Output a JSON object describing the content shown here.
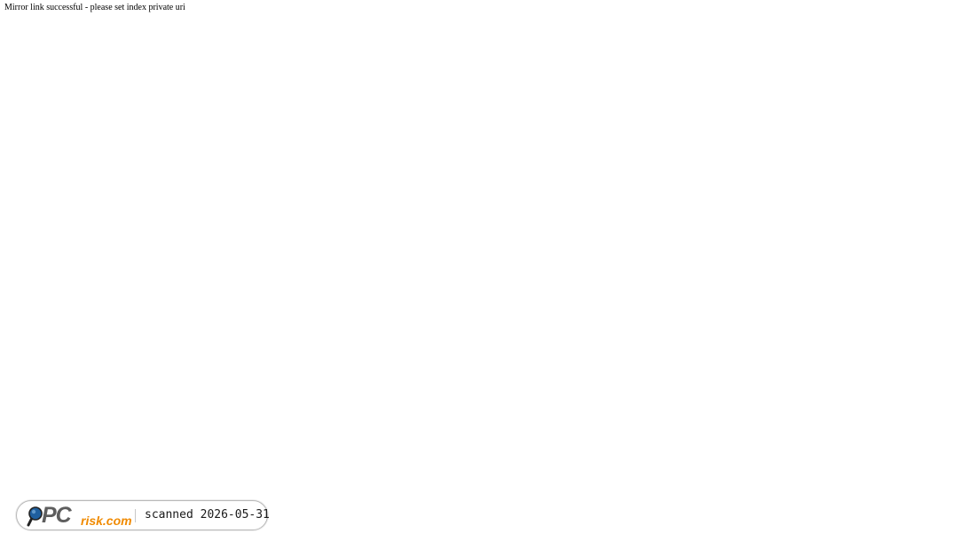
{
  "page": {
    "message": "Mirror link successful - please set index private uri"
  },
  "scan_badge": {
    "logo": {
      "pc_text": "PC",
      "risk_text": "risk.com",
      "icon": "magnifier-icon",
      "colors": {
        "pc": "#5e5e5e",
        "risk": "#f08a00",
        "lens": "#1f5f9e"
      }
    },
    "text": "scanned 2026-05-31"
  }
}
